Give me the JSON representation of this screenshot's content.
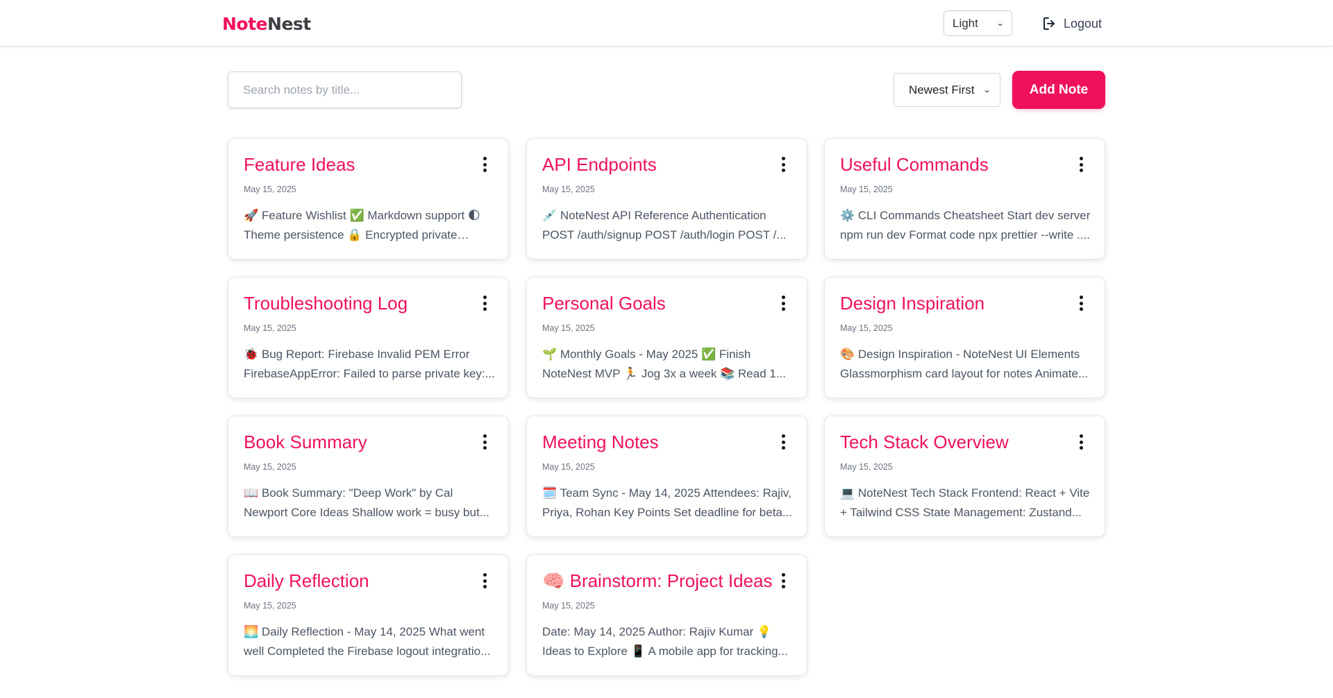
{
  "brand": {
    "part1": "Note",
    "part2": "Nest"
  },
  "header": {
    "theme_value": "Light",
    "logout_label": "Logout"
  },
  "toolbar": {
    "search_placeholder": "Search notes by title...",
    "sort_value": "Newest First",
    "add_label": "Add Note"
  },
  "colors": {
    "accent": "#f0115b",
    "brand_dark": "#3f3f46"
  },
  "notes": [
    {
      "title": "Feature Ideas",
      "date": "May 15, 2025",
      "preview": "🚀 Feature Wishlist ✅ Markdown support 🌓 Theme persistence 🔒 Encrypted private notes..."
    },
    {
      "title": "API Endpoints",
      "date": "May 15, 2025",
      "preview": "💉 NoteNest API Reference Authentication POST /auth/signup POST /auth/login POST /..."
    },
    {
      "title": "Useful Commands",
      "date": "May 15, 2025",
      "preview": "⚙️ CLI Commands Cheatsheet Start dev server npm run dev Format code npx prettier --write ...."
    },
    {
      "title": "Troubleshooting Log",
      "date": "May 15, 2025",
      "preview": "🐞 Bug Report: Firebase Invalid PEM Error FirebaseAppError: Failed to parse private key:..."
    },
    {
      "title": "Personal Goals",
      "date": "May 15, 2025",
      "preview": "🌱 Monthly Goals - May 2025 ✅ Finish NoteNest MVP 🏃 Jog 3x a week 📚 Read 1..."
    },
    {
      "title": "Design Inspiration",
      "date": "May 15, 2025",
      "preview": "🎨 Design Inspiration - NoteNest UI Elements Glassmorphism card layout for notes Animate..."
    },
    {
      "title": "Book Summary",
      "date": "May 15, 2025",
      "preview": "📖 Book Summary: \"Deep Work\" by Cal Newport Core Ideas Shallow work = busy but..."
    },
    {
      "title": "Meeting Notes",
      "date": "May 15, 2025",
      "preview": "🗓️ Team Sync - May 14, 2025 Attendees: Rajiv, Priya, Rohan Key Points Set deadline for beta..."
    },
    {
      "title": "Tech Stack Overview",
      "date": "May 15, 2025",
      "preview": "💻 NoteNest Tech Stack Frontend: React + Vite + Tailwind CSS State Management: Zustand..."
    },
    {
      "title": "Daily Reflection",
      "date": "May 15, 2025",
      "preview": "🌅 Daily Reflection - May 14, 2025 What went well Completed the Firebase logout integratio..."
    },
    {
      "title": "🧠 Brainstorm: Project Ideas",
      "date": "May 15, 2025",
      "preview": "Date: May 14, 2025 Author: Rajiv Kumar 💡 Ideas to Explore 📱 A mobile app for tracking..."
    }
  ]
}
